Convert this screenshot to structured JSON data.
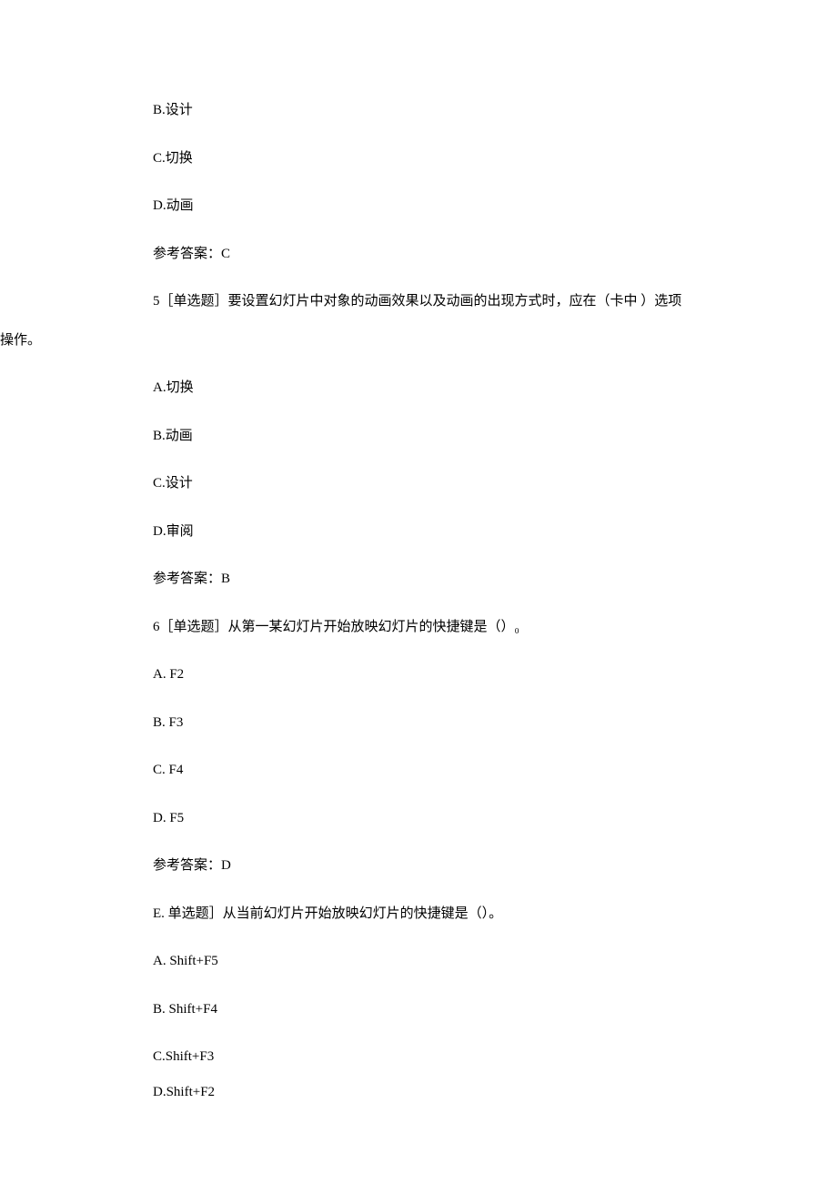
{
  "q4_remaining": {
    "option_b": "B.设计",
    "option_c": "C.切换",
    "option_d": "D.动画",
    "answer": "参考答案：C"
  },
  "q5": {
    "stem_part1": "5［单选题］要设置幻灯片中对象的动画效果以及动画的出现方式时，应在（卡中   ）选项",
    "stem_part2": "操作。",
    "option_a": "A.切换",
    "option_b": "B.动画",
    "option_c": "C.设计",
    "option_d": "D.审阅",
    "answer": "参考答案：B"
  },
  "q6": {
    "stem": "6［单选题］从第一某幻灯片开始放映幻灯片的快捷键是（）₀",
    "option_a": "A.  F2",
    "option_b": "B.  F3",
    "option_c": "C.  F4",
    "option_d": "D.  F5",
    "answer": "参考答案：D"
  },
  "q7": {
    "stem": "E.  单选题］从当前幻灯片开始放映幻灯片的快捷键是（）。",
    "option_a": "A.  Shift+F5",
    "option_b": "B.  Shift+F4",
    "option_c": "C.Shift+F3",
    "option_d": "D.Shift+F2"
  }
}
